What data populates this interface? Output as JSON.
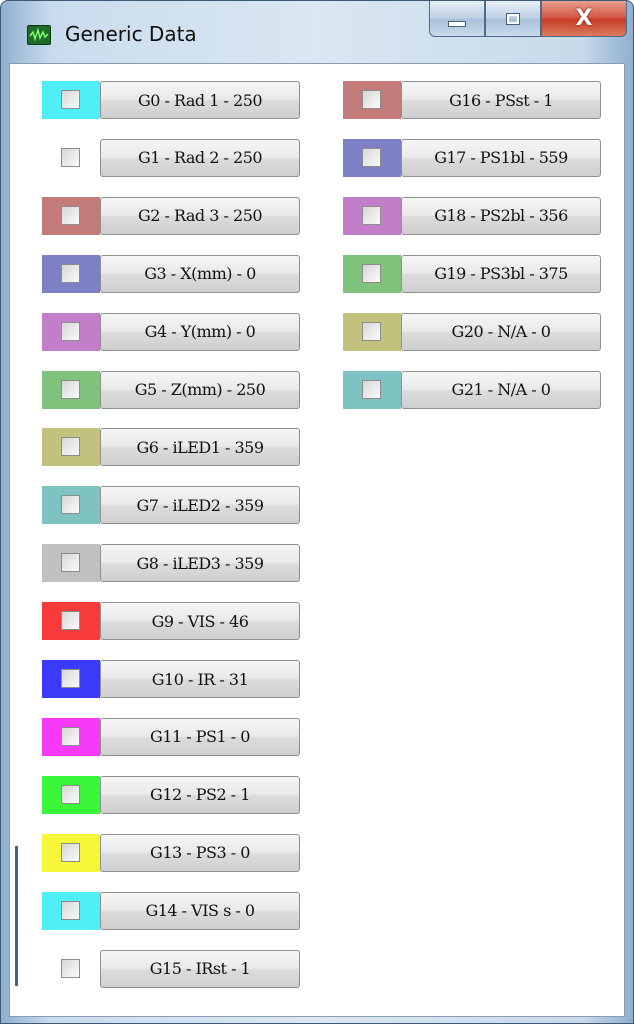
{
  "window": {
    "title": "Generic Data",
    "close_glyph": "X"
  },
  "left_column": [
    {
      "label": "G0 - Rad 1 - 250",
      "color": "#4ef0f6"
    },
    {
      "label": "G1 - Rad 2 - 250",
      "color": "#ffffff"
    },
    {
      "label": "G2 - Rad 3 - 250",
      "color": "#c27b79"
    },
    {
      "label": "G3 - X(mm) - 0",
      "color": "#7e80c6"
    },
    {
      "label": "G4 - Y(mm) - 0",
      "color": "#c27ec8"
    },
    {
      "label": "G5 - Z(mm) - 250",
      "color": "#7ec27c"
    },
    {
      "label": "G6 - iLED1 - 359",
      "color": "#c2c27e"
    },
    {
      "label": "G7 - iLED2 - 359",
      "color": "#7ec2c2"
    },
    {
      "label": "G8 - iLED3 - 359",
      "color": "#c0c0c0"
    },
    {
      "label": "G9 - VIS - 46",
      "color": "#f73a3a"
    },
    {
      "label": "G10 - IR - 31",
      "color": "#3a3af7"
    },
    {
      "label": "G11 - PS1 - 0",
      "color": "#f73af7"
    },
    {
      "label": "G12 - PS2 - 1",
      "color": "#3af73a"
    },
    {
      "label": "G13 - PS3 - 0",
      "color": "#f7f73a"
    },
    {
      "label": "G14 - VIS s - 0",
      "color": "#4ef0f6"
    },
    {
      "label": "G15 - IRst - 1",
      "color": "#ffffff"
    }
  ],
  "right_column": [
    {
      "label": "G16 - PSst - 1",
      "color": "#c27b79"
    },
    {
      "label": "G17 - PS1bl - 559",
      "color": "#7e80c6"
    },
    {
      "label": "G18 - PS2bl - 356",
      "color": "#c27ec8"
    },
    {
      "label": "G19 - PS3bl - 375",
      "color": "#7ec27c"
    },
    {
      "label": "G20 - N/A - 0",
      "color": "#c2c27e"
    },
    {
      "label": "G21 - N/A - 0",
      "color": "#7ec2c2"
    }
  ]
}
